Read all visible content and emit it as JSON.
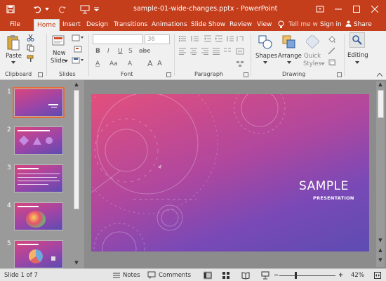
{
  "window": {
    "title": "sample-01-wide-changes.pptx - PowerPoint",
    "help_search": "Tell me w",
    "sign_in": "Sign in",
    "share": "Share"
  },
  "tabs": [
    "File",
    "Home",
    "Insert",
    "Design",
    "Transitions",
    "Animations",
    "Slide Show",
    "Review",
    "View"
  ],
  "ribbon": {
    "paste": "Paste",
    "new_slide": [
      "New",
      "Slide"
    ],
    "font_size": "36",
    "shapes": "Shapes",
    "arrange": "Arrange",
    "quick_styles": [
      "Quick",
      "Styles"
    ],
    "editing": "Editing",
    "groups": [
      "Clipboard",
      "Slides",
      "Font",
      "Paragraph",
      "Drawing"
    ]
  },
  "thumbnails": [
    "1",
    "2",
    "3",
    "4",
    "5"
  ],
  "slide": {
    "title": "SAMPLE",
    "subtitle": "PRESENTATION"
  },
  "status": {
    "slide_count": "Slide 1 of 7",
    "notes": "Notes",
    "comments": "Comments",
    "zoom": "42%"
  },
  "colors": {
    "accent": "#c43e1c",
    "ribbon_bg": "#f0f0f0",
    "workspace_bg": "#8c8c8c",
    "selected_thumb": "#e86a3a",
    "slide_gradient_start": "#e34f7c",
    "slide_gradient_end": "#5d4cb2"
  }
}
